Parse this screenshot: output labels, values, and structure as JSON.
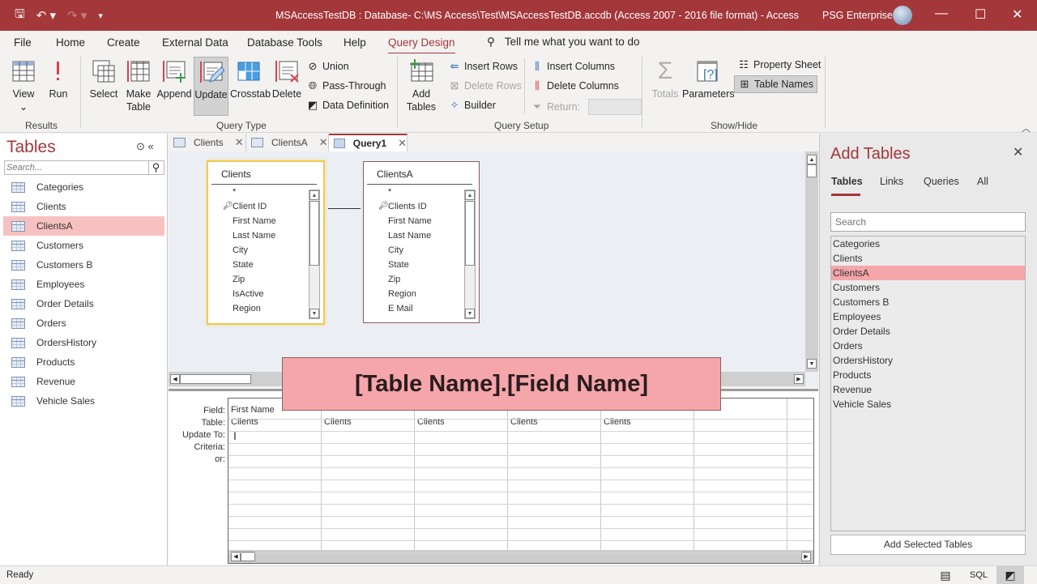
{
  "titlebar": {
    "title": "MSAccessTestDB : Database- C:\\MS Access\\Test\\MSAccessTestDB.accdb (Access 2007 - 2016 file format)  -  Access",
    "user": "PSG Enterprises",
    "qat": {
      "save": "save-icon",
      "undo": "undo-icon",
      "redo": "redo-icon",
      "customize": "customize-icon"
    },
    "minimize": "—",
    "maximize": "☐",
    "close": "✕"
  },
  "ribbon_tabs": [
    "File",
    "Home",
    "Create",
    "External Data",
    "Database Tools",
    "Help",
    "Query Design"
  ],
  "active_tab": "Query Design",
  "tell_me": "Tell me what you want to do",
  "ribbon": {
    "results": {
      "label": "Results",
      "view": "View",
      "view_arrow": "⌄",
      "run": "Run"
    },
    "query_type": {
      "label": "Query Type",
      "select": "Select",
      "make_table": "Make Table",
      "make_table_l1": "Make",
      "make_table_l2": "Table",
      "append": "Append",
      "update": "Update",
      "crosstab": "Crosstab",
      "delete": "Delete",
      "union": "Union",
      "pass_through": "Pass-Through",
      "data_definition": "Data Definition"
    },
    "query_setup": {
      "label": "Query Setup",
      "add_tables_l1": "Add",
      "add_tables_l2": "Tables",
      "insert_rows": "Insert Rows",
      "delete_rows": "Delete Rows",
      "builder": "Builder",
      "insert_columns": "Insert Columns",
      "delete_columns": "Delete Columns",
      "return_label": "Return:",
      "return_value": ""
    },
    "show_hide": {
      "label": "Show/Hide",
      "totals": "Totals",
      "parameters": "Parameters",
      "property_sheet": "Property Sheet",
      "table_names": "Table Names"
    }
  },
  "nav": {
    "title": "Tables",
    "search_placeholder": "Search...",
    "items": [
      "Categories",
      "Clients",
      "ClientsA",
      "Customers",
      "Customers B",
      "Employees",
      "Order Details",
      "Orders",
      "OrdersHistory",
      "Products",
      "Revenue",
      "Vehicle Sales"
    ],
    "selected": "ClientsA"
  },
  "doc_tabs": [
    {
      "label": "Clients",
      "close": "✕"
    },
    {
      "label": "ClientsA",
      "close": "✕"
    },
    {
      "label": "Query1",
      "close": "✕"
    }
  ],
  "design": {
    "tables": [
      {
        "name": "Clients",
        "fields": [
          "*",
          "Client ID",
          "First Name",
          "Last Name",
          "City",
          "State",
          "Zip",
          "IsActive",
          "Region"
        ],
        "key_field": "Client ID"
      },
      {
        "name": "ClientsA",
        "fields": [
          "*",
          "Clients ID",
          "First Name",
          "Last Name",
          "City",
          "State",
          "Zip",
          "Region",
          "E Mail"
        ],
        "key_field": "Clients ID"
      }
    ]
  },
  "overlay": {
    "text": "[Table Name].[Field Name]"
  },
  "grid": {
    "row_labels": [
      "Field:",
      "Table:",
      "Update To:",
      "Criteria:",
      "or:"
    ],
    "columns": [
      {
        "field": "First Name",
        "table": "Clients"
      },
      {
        "field": "",
        "table": "Clients"
      },
      {
        "field": "",
        "table": "Clients"
      },
      {
        "field": "",
        "table": "Clients"
      },
      {
        "field": "",
        "table": "Clients"
      },
      {
        "field": "",
        "table": ""
      }
    ]
  },
  "add_tables": {
    "title": "Add Tables",
    "close": "✕",
    "tabs": [
      "Tables",
      "Links",
      "Queries",
      "All"
    ],
    "active_tab": "Tables",
    "search_placeholder": "Search",
    "items": [
      "Categories",
      "Clients",
      "ClientsA",
      "Customers",
      "Customers B",
      "Employees",
      "Order Details",
      "Orders",
      "OrdersHistory",
      "Products",
      "Revenue",
      "Vehicle Sales"
    ],
    "selected": "ClientsA",
    "add_button": "Add Selected Tables"
  },
  "status": {
    "text": "Ready",
    "sql": "SQL"
  }
}
